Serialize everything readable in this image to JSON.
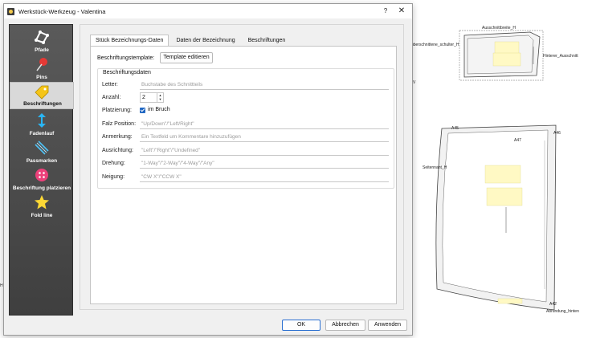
{
  "window": {
    "title": "Werkstück-Werkzeug - Valentina",
    "help": "?",
    "close": "✕"
  },
  "sidebar": {
    "items": [
      {
        "label": "Pfade",
        "icon": "path-icon",
        "active": false
      },
      {
        "label": "Pins",
        "icon": "pin-icon",
        "active": false
      },
      {
        "label": "Beschriftungen",
        "icon": "label-tag-icon",
        "active": true
      },
      {
        "label": "Fadenlauf",
        "icon": "grainline-icon",
        "active": false
      },
      {
        "label": "Passmarken",
        "icon": "notch-icon",
        "active": false
      },
      {
        "label": "Beschriftung platzieren",
        "icon": "button-place-icon",
        "active": false
      },
      {
        "label": "Fold line",
        "icon": "star-icon",
        "active": false
      }
    ]
  },
  "tabs": [
    {
      "label": "Stück Bezeichnungs-Daten",
      "active": true
    },
    {
      "label": "Daten der Bezeichnung",
      "active": false
    },
    {
      "label": "Beschriftungen",
      "active": false
    }
  ],
  "template": {
    "label": "Beschriftungstemplate:",
    "button": "Template editieren"
  },
  "group": {
    "title": "Beschriftungsdaten",
    "letter_label": "Letter:",
    "letter_placeholder": "Buchstabe des Schnittteils",
    "quantity_label": "Anzahl:",
    "quantity_value": "2",
    "placement_label": "Platzierung:",
    "fold_label": "im Bruch",
    "fold_checked": true,
    "fold_position_label": "Falz Position:",
    "fold_position_placeholder": "\"Up/Down\"/\"Left/Right\"",
    "annotation_label": "Anmerkung:",
    "annotation_placeholder": "Ein Textfeld um Kommentare hinzuzufügen",
    "orientation_label": "Ausrichtung:",
    "orientation_placeholder": "\"Left\"/\"Right\"/\"Undefined\"",
    "rotation_label": "Drehung:",
    "rotation_placeholder": "\"1-Way\"/\"2-Way\"/\"4-Way\"/\"Any\"",
    "tilt_label": "Neigung:",
    "tilt_placeholder": "\"CW X\"/\"CCW X\""
  },
  "buttons": {
    "ok": "OK",
    "cancel": "Abbrechen",
    "apply": "Anwenden"
  },
  "canvas": {
    "labels": {
      "ausschnittbreite": "Ausschnittbreite_H",
      "schulter": "überschnittene_schulter_H",
      "hinterer": "Hinterer_Ausschnitt",
      "v_mark": "V",
      "a45": "A45",
      "a46": "A46",
      "a47": "A47",
      "seitennaht": "Seitennaht_H",
      "a42": "A42",
      "abrundung": "Abrundung_hinten",
      "left_mark": "H"
    }
  }
}
